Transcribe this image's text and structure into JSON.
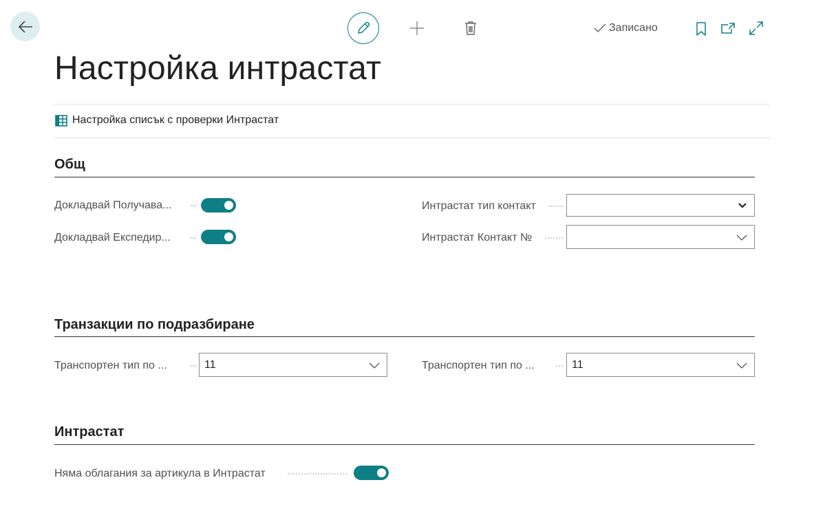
{
  "toolbar": {
    "back_icon": "arrow-left-icon",
    "edit_icon": "pencil-icon",
    "new_icon": "plus-icon",
    "delete_icon": "trash-icon",
    "saved_label": "Записано",
    "bookmark_icon": "bookmark-icon",
    "open_new_window_icon": "open-in-new-window-icon",
    "expand_icon": "expand-icon"
  },
  "page": {
    "title": "Настройка интрастат"
  },
  "actions": [
    {
      "label": "Настройка списък с проверки Интрастат",
      "icon": "table-icon"
    }
  ],
  "sections": {
    "general": {
      "title": "Общ",
      "fields": {
        "report_receipts": {
          "label": "Докладвай Получава...",
          "value": true
        },
        "report_shipments": {
          "label": "Докладвай Експедир...",
          "value": true
        },
        "contact_type": {
          "label": "Интрастат тип контакт",
          "value": ""
        },
        "contact_no": {
          "label": "Интрастат Контакт №",
          "value": ""
        }
      }
    },
    "default_transactions": {
      "title": "Транзакции по подразбиране",
      "fields": {
        "transport_type_1": {
          "label": "Транспортен тип по ...",
          "value": "11"
        },
        "transport_type_2": {
          "label": "Транспортен тип по ...",
          "value": "11"
        }
      }
    },
    "intrastat": {
      "title": "Интрастат",
      "fields": {
        "no_item_charges": {
          "label": "Няма облагания за артикула в Интрастат",
          "value": true
        }
      }
    }
  },
  "colors": {
    "accent": "#0f7f86",
    "back_bg": "#ddeef1",
    "text": "#222222",
    "label": "#505050"
  }
}
